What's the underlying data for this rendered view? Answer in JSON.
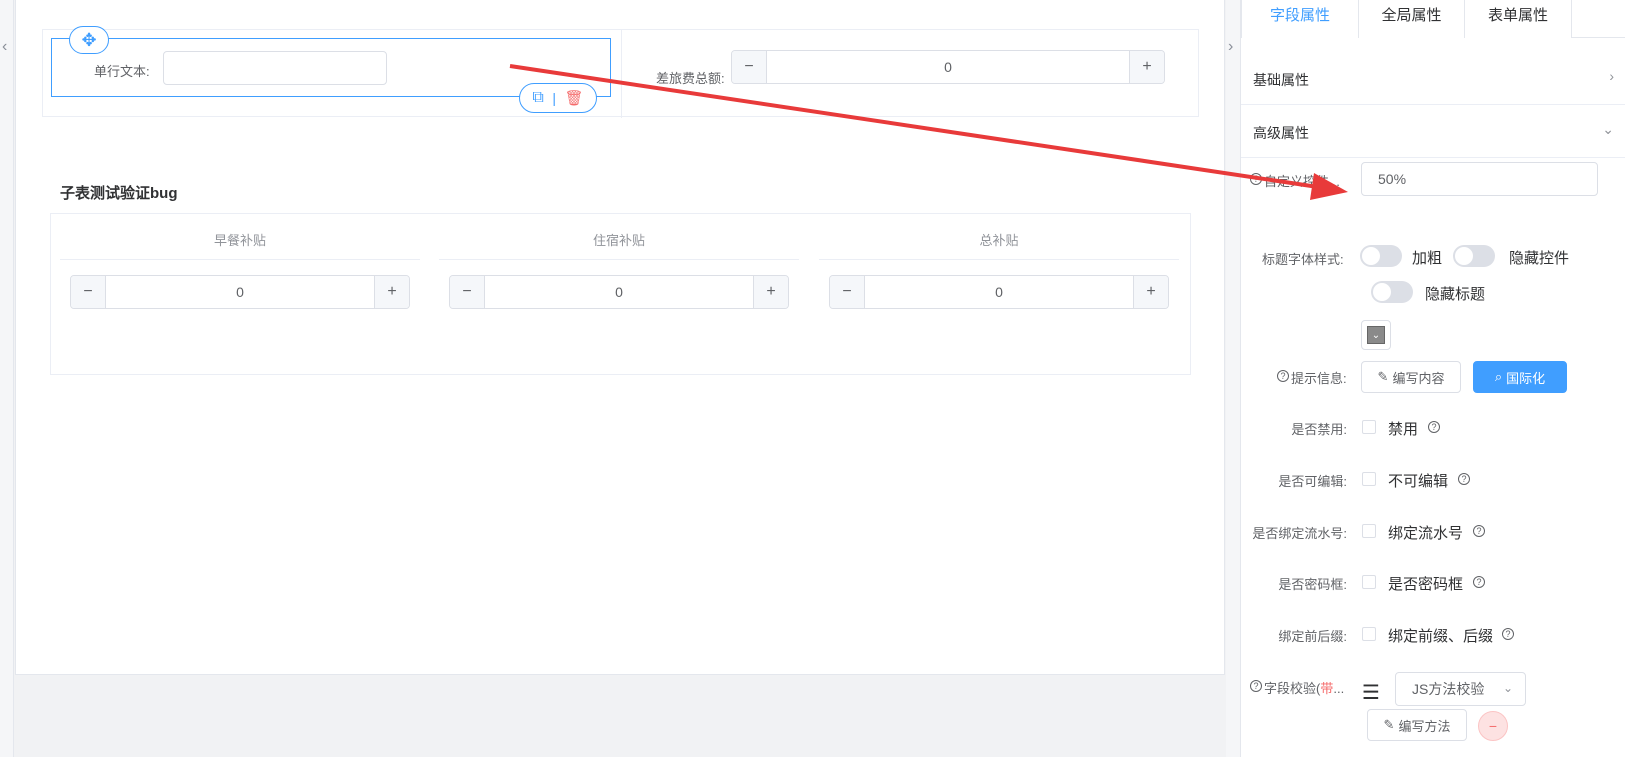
{
  "canvas": {
    "text_widget_label": "单行文本:",
    "text_widget_value": "",
    "number_widget_label": "差旅费总额:",
    "number_widget_value": "0",
    "subform_title": "子表测试验证bug",
    "subform_columns": [
      {
        "header": "早餐补贴",
        "value": "0"
      },
      {
        "header": "住宿补贴",
        "value": "0"
      },
      {
        "header": "总补贴",
        "value": "0"
      }
    ],
    "stepper_minus": "−",
    "stepper_plus": "+"
  },
  "panel": {
    "tabs": [
      "字段属性",
      "全局属性",
      "表单属性"
    ],
    "active_tab": "字段属性",
    "sections": {
      "basic": "基础属性",
      "advanced": "高级属性"
    },
    "custom_width_label": "自定义控件...",
    "custom_width_value": "50%",
    "title_style_label": "标题字体样式:",
    "switches": {
      "bold": "加粗",
      "hide_control": "隐藏控件",
      "hide_title": "隐藏标题"
    },
    "tip_label": "提示信息:",
    "edit_content_btn": "编写内容",
    "i18n_btn": "国际化",
    "checks": [
      {
        "label": "是否禁用:",
        "text": "禁用"
      },
      {
        "label": "是否可编辑:",
        "text": "不可编辑"
      },
      {
        "label": "是否绑定流水号:",
        "text": "绑定流水号"
      },
      {
        "label": "是否密码框:",
        "text": "是否密码框"
      },
      {
        "label": "绑定前后缀:",
        "text": "绑定前缀、后缀"
      }
    ],
    "validation_label": "字段校验(",
    "validation_label_red": "带",
    "validation_label_tail": "...",
    "validation_select": "JS方法校验",
    "write_method_btn": "编写方法",
    "remove_symbol": "−"
  },
  "colors": {
    "accent": "#409eff",
    "danger": "#f56c6c",
    "annotation_arrow": "#e83a3a"
  },
  "icons": [
    "move-icon",
    "copy-icon",
    "trash-icon",
    "chevron-right-icon",
    "chevron-down-icon",
    "help-icon",
    "edit-icon",
    "search-icon",
    "menu-icon"
  ]
}
